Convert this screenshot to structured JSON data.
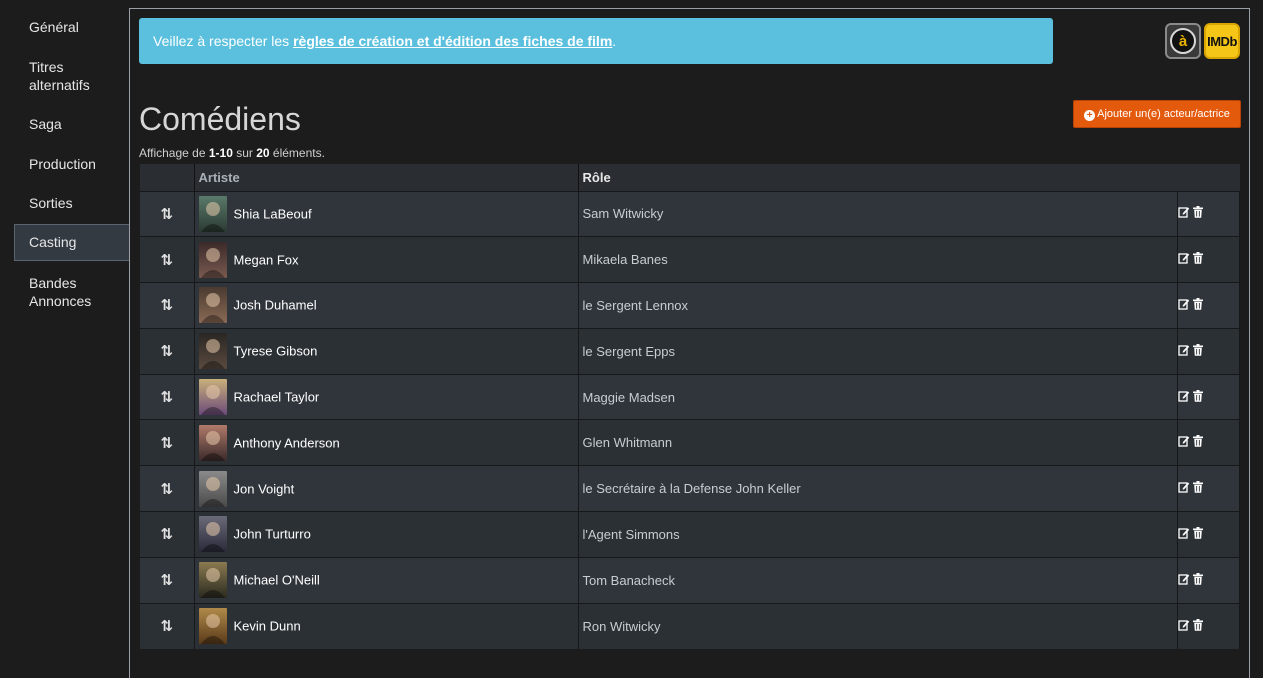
{
  "sidebar": {
    "items": [
      {
        "label": "Général",
        "active": false
      },
      {
        "label": "Titres alternatifs",
        "active": false
      },
      {
        "label": "Saga",
        "active": false
      },
      {
        "label": "Production",
        "active": false
      },
      {
        "label": "Sorties",
        "active": false
      },
      {
        "label": "Casting",
        "active": true
      },
      {
        "label": "Bandes Annonces",
        "active": false
      }
    ]
  },
  "alert": {
    "prefix": "Veillez à respecter les ",
    "link": "règles de création et d'édition des fiches de film",
    "suffix": "."
  },
  "badges": {
    "imdb_label": "IMDb",
    "first_icon": "allocine-icon",
    "first_glyph": "à"
  },
  "page": {
    "title": "Comédiens",
    "add_button_label": "Ajouter un(e) acteur/actrice"
  },
  "summary": {
    "prefix": "Affichage de ",
    "range": "1-10",
    "middle": " sur ",
    "total": "20",
    "suffix": " éléments."
  },
  "table": {
    "headers": {
      "drag": "",
      "artist": "Artiste",
      "role": "Rôle",
      "actions": ""
    },
    "drag_glyph": "⇅",
    "rows": [
      {
        "artist": "Shia LaBeouf",
        "role": "Sam Witwicky"
      },
      {
        "artist": "Megan Fox",
        "role": "Mikaela Banes"
      },
      {
        "artist": "Josh Duhamel",
        "role": "le Sergent Lennox"
      },
      {
        "artist": "Tyrese Gibson",
        "role": "le Sergent Epps"
      },
      {
        "artist": "Rachael Taylor",
        "role": "Maggie Madsen"
      },
      {
        "artist": "Anthony Anderson",
        "role": "Glen Whitmann"
      },
      {
        "artist": "Jon Voight",
        "role": "le Secrétaire à la Defense John Keller"
      },
      {
        "artist": "John Turturro",
        "role": "l'Agent Simmons"
      },
      {
        "artist": "Michael O'Neill",
        "role": "Tom Banacheck"
      },
      {
        "artist": "Kevin Dunn",
        "role": "Ron Witwicky"
      }
    ]
  },
  "colors": {
    "alert_bg": "#5bc0de",
    "button_bg": "#e45a0d",
    "row_odd": "#30353b",
    "row_even": "#2b3035",
    "page_bg": "#1c1c1d"
  }
}
